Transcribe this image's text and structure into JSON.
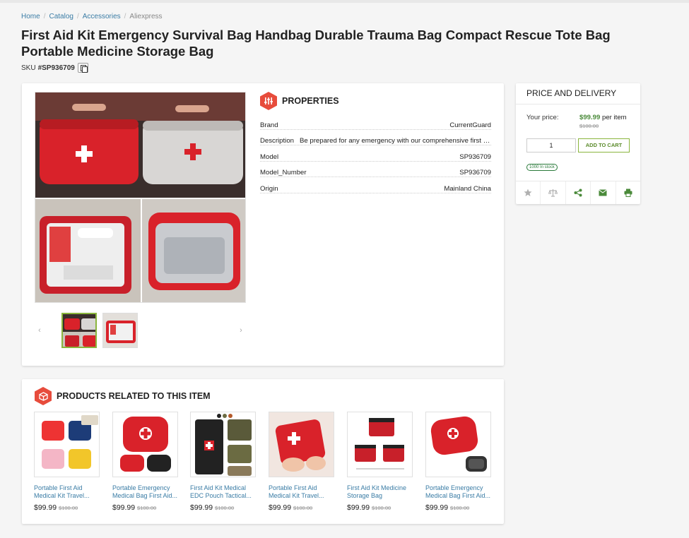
{
  "breadcrumb": {
    "home": "Home",
    "catalog": "Catalog",
    "accessories": "Accessories",
    "current": "Aliexpress"
  },
  "title": "First Aid Kit Emergency Survival Bag Handbag Durable Trauma Bag Compact Rescue Tote Bag Portable Medicine Storage Bag",
  "sku": {
    "label": "SKU",
    "value": "#SP936709"
  },
  "properties": {
    "heading": "PROPERTIES",
    "rows": [
      {
        "key": "Brand",
        "value": "CurrentGuard"
      },
      {
        "key": "Description",
        "value": "Be prepared for any emergency with our comprehensive first aid kit"
      },
      {
        "key": "Model",
        "value": "SP936709"
      },
      {
        "key": "Model_Number",
        "value": "SP936709"
      },
      {
        "key": "Origin",
        "value": "Mainland China"
      }
    ]
  },
  "price": {
    "heading": "PRICE AND DELIVERY",
    "your_price_label": "Your price:",
    "current": "$99.99",
    "per_item": "per item",
    "old": "$100.00",
    "quantity": "1",
    "add_to_cart": "ADD TO CART",
    "stock": "1000 In stock"
  },
  "actions": [
    "star-icon",
    "compare-icon",
    "share-icon",
    "mail-icon",
    "print-icon"
  ],
  "related": {
    "heading": "PRODUCTS RELATED TO THIS ITEM",
    "items": [
      {
        "name": "Portable First Aid Medical Kit Travel...",
        "price": "$99.99",
        "old": "$100.00"
      },
      {
        "name": "Portable Emergency Medical Bag First Aid...",
        "price": "$99.99",
        "old": "$100.00"
      },
      {
        "name": "First Aid Kit Medical EDC Pouch Tactical...",
        "price": "$99.99",
        "old": "$100.00"
      },
      {
        "name": "Portable First Aid Medical Kit Travel...",
        "price": "$99.99",
        "old": "$100.00"
      },
      {
        "name": "First Aid Kit Medicine Storage Bag Portable...",
        "price": "$99.99",
        "old": "$100.00"
      },
      {
        "name": "Portable Emergency Medical Bag First Aid...",
        "price": "$99.99",
        "old": "$100.00"
      }
    ]
  },
  "colors": {
    "accent_red": "#e74c3c",
    "price_green": "#4a8a3a",
    "link_blue": "#3a7ca5",
    "cart_border": "#8ab53d"
  }
}
